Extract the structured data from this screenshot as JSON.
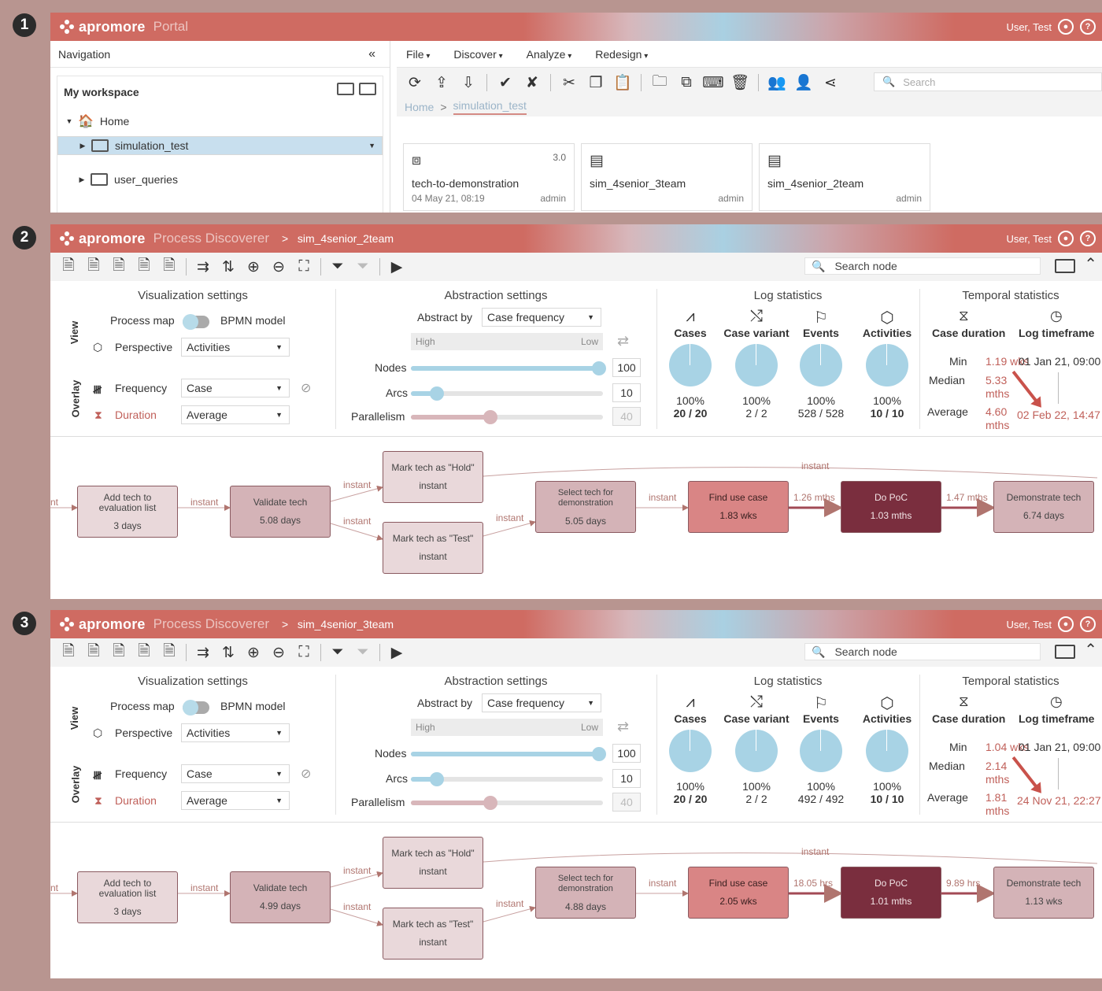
{
  "markers": [
    "1",
    "2",
    "3"
  ],
  "brand": {
    "logo": "apromore",
    "accent": "#cf6b62",
    "highlight": "#c8dfee"
  },
  "user": {
    "name": "User, Test",
    "help": "?"
  },
  "portal": {
    "app": "Portal",
    "nav": {
      "title": "Navigation",
      "collapse": "«",
      "workspace": "My workspace",
      "tree": [
        {
          "label": "Home"
        },
        {
          "label": "simulation_test"
        },
        {
          "label": "user_queries"
        }
      ]
    },
    "menu": [
      "File",
      "Discover",
      "Analyze",
      "Redesign"
    ],
    "search_placeholder": "Search",
    "breadcrumb": {
      "home": "Home",
      "sep": ">",
      "current": "simulation_test"
    },
    "cards": [
      {
        "name": "tech-to-demonstration",
        "version": "3.0",
        "date": "04 May 21, 08:19",
        "owner": "admin",
        "icon": "process-model-icon"
      },
      {
        "name": "sim_4senior_3team",
        "version": "",
        "date": "",
        "owner": "admin",
        "icon": "log-icon"
      },
      {
        "name": "sim_4senior_2team",
        "version": "",
        "date": "",
        "owner": "admin",
        "icon": "log-icon"
      }
    ]
  },
  "common": {
    "app": "Process Discoverer",
    "crumb_sep": ">",
    "search_node": "Search node",
    "vis_title": "Visualization settings",
    "view": "View",
    "overlay": "Overlay",
    "process_map": "Process map",
    "bpmn_model": "BPMN model",
    "perspective": "Perspective",
    "perspective_value": "Activities",
    "frequency": "Frequency",
    "frequency_value": "Case",
    "duration": "Duration",
    "duration_value": "Average",
    "abs_title": "Abstraction settings",
    "abstract_by": "Abstract by",
    "abstract_by_value": "Case frequency",
    "high": "High",
    "low": "Low",
    "nodes": "Nodes",
    "nodes_value": "100",
    "arcs": "Arcs",
    "arcs_value": "10",
    "parallelism": "Parallelism",
    "parallelism_value": "40",
    "log_title": "Log statistics",
    "cases": "Cases",
    "case_variant": "Case variant",
    "events": "Events",
    "activities": "Activities",
    "temp_title": "Temporal statistics",
    "case_duration": "Case duration",
    "log_timeframe": "Log timeframe",
    "min": "Min",
    "median": "Median",
    "average": "Average"
  },
  "discoverers": [
    {
      "log": "sim_4senior_2team",
      "stats": {
        "cases": {
          "pct": "100%",
          "frac": "20 / 20"
        },
        "variants": {
          "pct": "100%",
          "frac": "2 / 2"
        },
        "events": {
          "pct": "100%",
          "frac": "528 / 528"
        },
        "activities": {
          "pct": "100%",
          "frac": "10 / 10"
        }
      },
      "temporal": {
        "min": "1.19 wks",
        "median": "5.33 mths",
        "average": "4.60 mths",
        "start": "01 Jan 21, 09:00",
        "end": "02 Feb 22, 14:47"
      },
      "graph": {
        "entry_label": "nt",
        "nodes": [
          {
            "name": "Add tech to evaluation list",
            "value": "3 days"
          },
          {
            "name": "Validate tech",
            "value": "5.08 days"
          },
          {
            "name": "Mark tech as \"Hold\"",
            "value": "instant"
          },
          {
            "name": "Mark tech as \"Test\"",
            "value": "instant"
          },
          {
            "name": "Select tech for demonstration",
            "value": "5.05 days"
          },
          {
            "name": "Find use case",
            "value": "1.83 wks"
          },
          {
            "name": "Do PoC",
            "value": "1.03 mths"
          },
          {
            "name": "Demonstrate tech",
            "value": "6.74 days"
          }
        ],
        "edges": [
          "instant",
          "instant",
          "instant",
          "instant",
          "instant",
          "instant",
          "1.26 mths",
          "1.47 mths",
          "instant"
        ]
      }
    },
    {
      "log": "sim_4senior_3team",
      "stats": {
        "cases": {
          "pct": "100%",
          "frac": "20 / 20"
        },
        "variants": {
          "pct": "100%",
          "frac": "2 / 2"
        },
        "events": {
          "pct": "100%",
          "frac": "492 / 492"
        },
        "activities": {
          "pct": "100%",
          "frac": "10 / 10"
        }
      },
      "temporal": {
        "min": "1.04 wks",
        "median": "2.14 mths",
        "average": "1.81 mths",
        "start": "01 Jan 21, 09:00",
        "end": "24 Nov 21, 22:27"
      },
      "graph": {
        "entry_label": "nt",
        "nodes": [
          {
            "name": "Add tech to evaluation list",
            "value": "3 days"
          },
          {
            "name": "Validate tech",
            "value": "4.99 days"
          },
          {
            "name": "Mark tech as \"Hold\"",
            "value": "instant"
          },
          {
            "name": "Mark tech as \"Test\"",
            "value": "instant"
          },
          {
            "name": "Select tech for demonstration",
            "value": "4.88 days"
          },
          {
            "name": "Find use case",
            "value": "2.05 wks"
          },
          {
            "name": "Do PoC",
            "value": "1.01 mths"
          },
          {
            "name": "Demonstrate tech",
            "value": "1.13 wks"
          }
        ],
        "edges": [
          "instant",
          "instant",
          "instant",
          "instant",
          "instant",
          "instant",
          "18.05 hrs",
          "9.89 hrs",
          "instant"
        ]
      }
    }
  ]
}
